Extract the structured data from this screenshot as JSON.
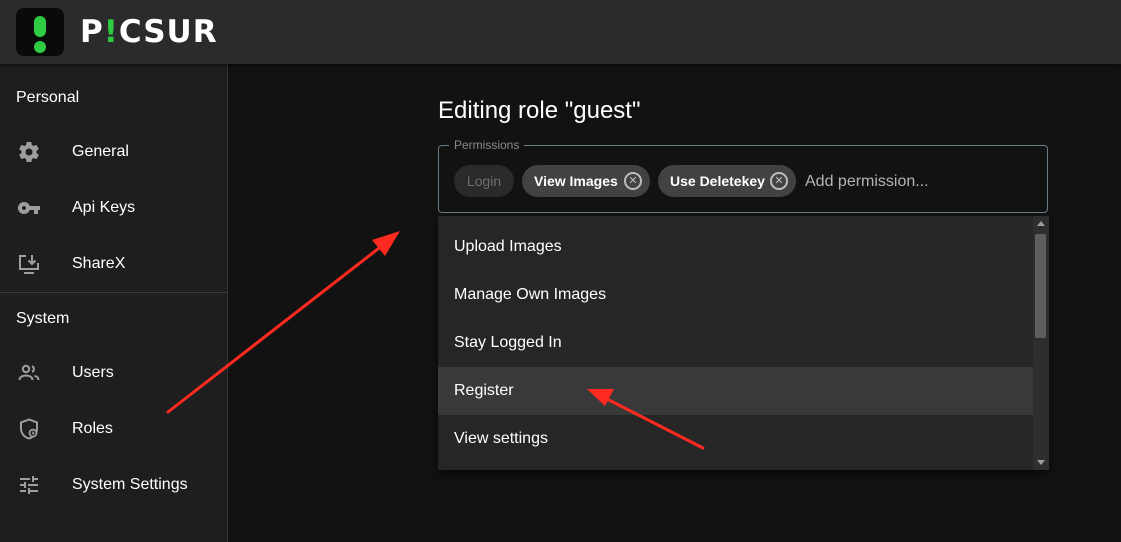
{
  "app": {
    "name_prefix": "P",
    "name_bang": "!",
    "name_suffix": "CSUR"
  },
  "sidebar": {
    "personal_title": "Personal",
    "personal_items": [
      {
        "label": "General",
        "icon": "gear-icon"
      },
      {
        "label": "Api Keys",
        "icon": "key-icon"
      },
      {
        "label": "ShareX",
        "icon": "download-screen-icon"
      }
    ],
    "system_title": "System",
    "system_items": [
      {
        "label": "Users",
        "icon": "users-icon"
      },
      {
        "label": "Roles",
        "icon": "shield-icon"
      },
      {
        "label": "System Settings",
        "icon": "sliders-icon"
      }
    ]
  },
  "main": {
    "title": "Editing role \"guest\"",
    "permissions": {
      "legend": "Permissions",
      "chips": [
        {
          "label": "Login",
          "disabled": true
        },
        {
          "label": "View Images",
          "disabled": false
        },
        {
          "label": "Use Deletekey",
          "disabled": false
        }
      ],
      "placeholder": "Add permission...",
      "remove_icon": "cancel-circle-icon"
    },
    "dropdown": {
      "options": [
        "Upload Images",
        "Manage Own Images",
        "Stay Logged In",
        "Register",
        "View settings"
      ],
      "highlighted": "Register"
    }
  },
  "colors": {
    "accent": "#2ecc40",
    "annotation_arrow": "#ff2a1f",
    "highlight_row": "#393939"
  }
}
